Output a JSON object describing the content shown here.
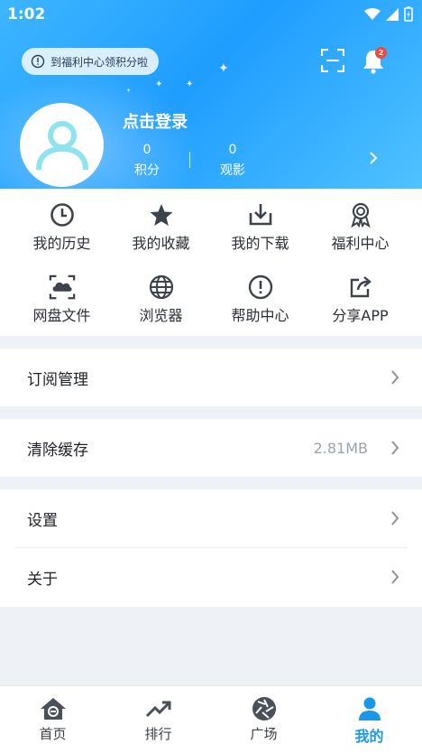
{
  "status_bar": {
    "time": "1:02"
  },
  "header": {
    "promo_text": "到福利中心领积分啦",
    "notification_count": "2",
    "login_text": "点击登录",
    "stats": [
      {
        "value": "0",
        "label": "积分"
      },
      {
        "value": "0",
        "label": "观影"
      }
    ]
  },
  "quick_grid": [
    {
      "label": "我的历史",
      "icon": "history-icon"
    },
    {
      "label": "我的收藏",
      "icon": "star-icon"
    },
    {
      "label": "我的下载",
      "icon": "download-icon"
    },
    {
      "label": "福利中心",
      "icon": "award-icon"
    },
    {
      "label": "网盘文件",
      "icon": "cloud-drive-icon"
    },
    {
      "label": "浏览器",
      "icon": "globe-icon"
    },
    {
      "label": "帮助中心",
      "icon": "help-icon"
    },
    {
      "label": "分享APP",
      "icon": "share-icon"
    }
  ],
  "menu": {
    "subscription": "订阅管理",
    "clear_cache": "清除缓存",
    "cache_size": "2.81MB",
    "settings": "设置",
    "about": "关于"
  },
  "tabbar": [
    {
      "label": "首页",
      "icon": "home-icon"
    },
    {
      "label": "排行",
      "icon": "trending-icon"
    },
    {
      "label": "广场",
      "icon": "aperture-icon"
    },
    {
      "label": "我的",
      "icon": "person-icon",
      "active": true
    }
  ],
  "colors": {
    "accent": "#1a97e6",
    "header_gradient_start": "#3db6ff",
    "header_gradient_end": "#4fc2ff",
    "badge": "#f04a3c",
    "avatar_icon": "#8fe3ee"
  }
}
